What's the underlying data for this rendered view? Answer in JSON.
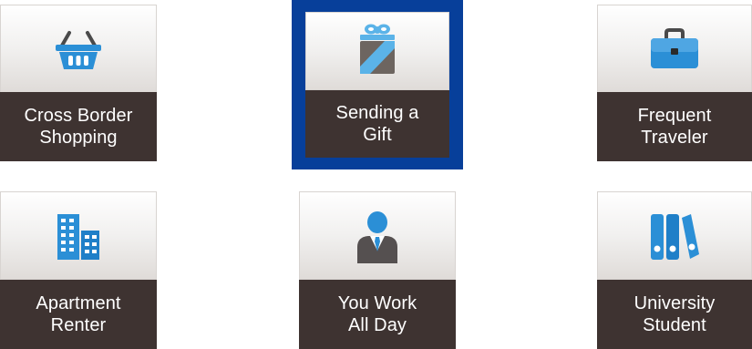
{
  "tiles": [
    {
      "id": "cross-border-shopping",
      "line1": "Cross Border",
      "line2": "Shopping",
      "icon": "shopping-basket-icon",
      "selected": false
    },
    {
      "id": "sending-a-gift",
      "line1": "Sending a",
      "line2": "Gift",
      "icon": "gift-icon",
      "selected": true
    },
    {
      "id": "frequent-traveler",
      "line1": "Frequent",
      "line2": "Traveler",
      "icon": "briefcase-icon",
      "selected": false
    },
    {
      "id": "apartment-renter",
      "line1": "Apartment",
      "line2": "Renter",
      "icon": "building-icon",
      "selected": false
    },
    {
      "id": "you-work-all-day",
      "line1": "You Work",
      "line2": "All Day",
      "icon": "businessman-icon",
      "selected": false
    },
    {
      "id": "university-student",
      "line1": "University",
      "line2": "Student",
      "icon": "binders-icon",
      "selected": false
    }
  ],
  "colors": {
    "icon_blue": "#2b8fd6",
    "icon_blue_dark": "#1565a8",
    "label_bg": "#3e3331",
    "selected_border": "#073f9a",
    "gift_ribbon": "#5bb3e8",
    "gift_box": "#6d6560"
  }
}
